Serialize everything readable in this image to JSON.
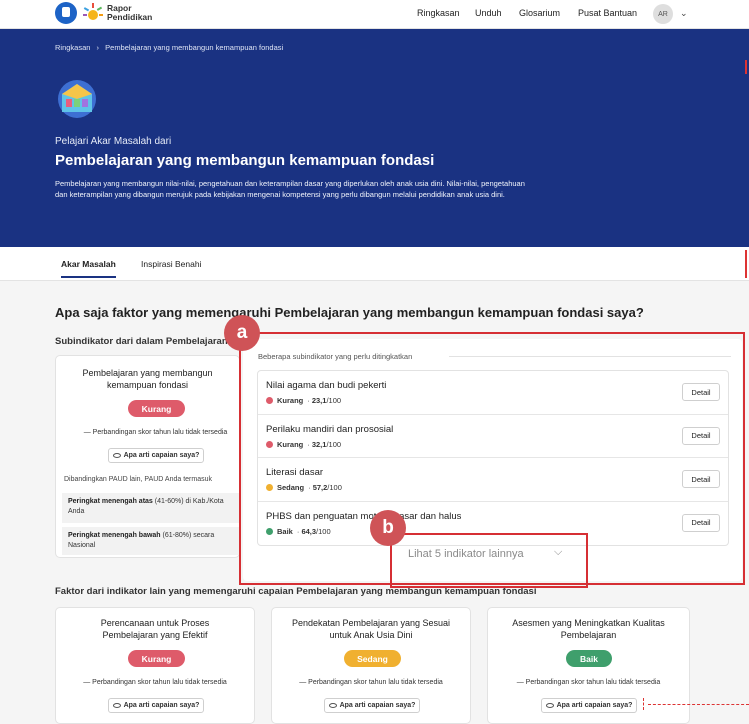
{
  "nav": {
    "brand_line1": "Rapor",
    "brand_line2": "Pendidikan",
    "links": [
      "Ringkasan",
      "Unduh",
      "Glosarium",
      "Pusat Bantuan"
    ],
    "avatar": "AR"
  },
  "hero": {
    "crumb_root": "Ringkasan",
    "crumb_sep": "›",
    "crumb_current": "Pembelajaran yang membangun kemampuan fondasi",
    "subtitle": "Pelajari Akar Masalah dari",
    "title": "Pembelajaran yang membangun kemampuan fondasi",
    "desc": "Pembelajaran yang membangun nilai-nilai, pengetahuan dan keterampilan dasar yang diperlukan oleh anak usia dini. Nilai-nilai, pengetahuan dan keterampilan yang dibangun merujuk pada kebijakan mengenai kompetensi yang perlu dibangun melalui pendidikan anak usia dini."
  },
  "tabs": [
    "Akar Masalah",
    "Inspirasi Benahi"
  ],
  "main": {
    "question": "Apa saja faktor yang memengaruhi Pembelajaran yang membangun kemampuan fondasi saya?",
    "sub_heading": "Subindikator dari dalam Pembelajaran",
    "left_card": {
      "title_l1": "Pembelajaran yang membangun",
      "title_l2": "kemampuan fondasi",
      "status": "Kurang",
      "compare": "— Perbandingan skor tahun lalu tidak tersedia",
      "btn": "Apa arti capaian saya?",
      "note": "Dibandingkan PAUD lain, PAUD Anda termasuk",
      "rank1_b": "Peringkat menengah atas",
      "rank1": " (41-60%) di Kab./Kota Anda",
      "rank2_b": "Peringkat menengah bawah",
      "rank2": " (61-80%) secara Nasional"
    },
    "panel_label": "Beberapa subindikator yang perlu ditingkatkan",
    "items": [
      {
        "name": "Nilai agama dan budi pekerti",
        "status": "Kurang",
        "score": "23,1",
        "max": "/100",
        "color": "#de5b6a",
        "detail": "Detail"
      },
      {
        "name": "Perilaku mandiri dan prososial",
        "status": "Kurang",
        "score": "32,1",
        "max": "/100",
        "color": "#de5b6a",
        "detail": "Detail"
      },
      {
        "name": "Literasi dasar",
        "status": "Sedang",
        "score": "57,2",
        "max": "/100",
        "color": "#f0b030",
        "detail": "Detail"
      },
      {
        "name": "PHBS dan penguatan motorik kasar dan halus",
        "status": "Baik",
        "score": "64,3",
        "max": "/100",
        "color": "#3f9f6c",
        "detail": "Detail"
      }
    ],
    "more": "Lihat 5 indikator lainnya",
    "factor_heading": "Faktor dari indikator lain yang memengaruhi capaian Pembelajaran yang membangun kemampuan fondasi",
    "factors": [
      {
        "l1": "Perencanaan untuk Proses",
        "l2": "Pembelajaran yang Efektif",
        "status": "Kurang",
        "compare": "— Perbandingan skor tahun lalu tidak tersedia",
        "btn": "Apa arti capaian saya?"
      },
      {
        "l1": "Pendekatan Pembelajaran yang Sesuai",
        "l2": "untuk Anak Usia Dini",
        "status": "Sedang",
        "compare": "— Perbandingan skor tahun lalu tidak tersedia",
        "btn": "Apa arti capaian saya?"
      },
      {
        "l1": "Asesmen yang Meningkatkan Kualitas",
        "l2": "Pembelajaran",
        "status": "Baik",
        "compare": "— Perbandingan skor tahun lalu tidak tersedia",
        "btn": "Apa arti capaian saya?"
      }
    ]
  },
  "annotations": {
    "a": "a",
    "b": "b"
  },
  "colors": {
    "navy": "#1a3282",
    "red": "#de5b6a",
    "orange": "#f0b030",
    "green": "#3f9f6c",
    "annotation": "#d62f34"
  }
}
